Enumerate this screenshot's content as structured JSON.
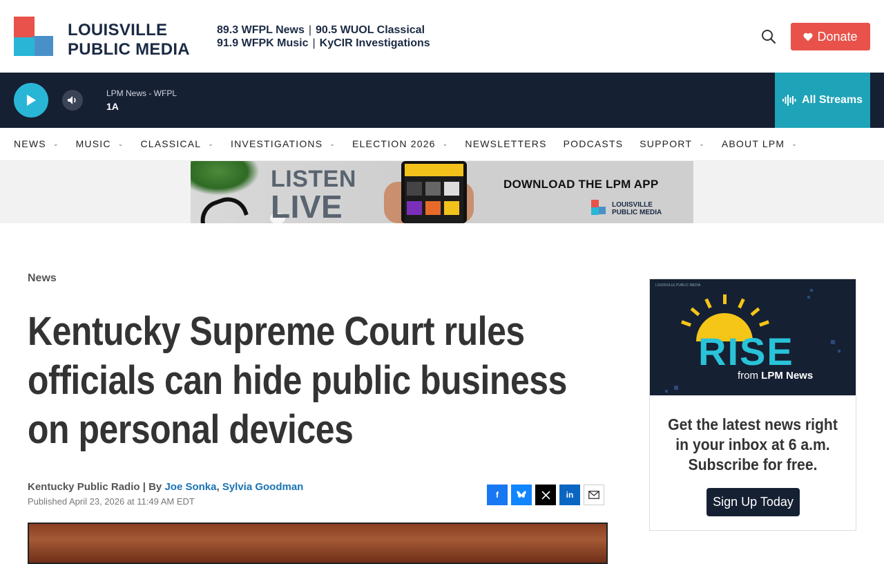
{
  "header": {
    "logo_line1": "LOUISVILLE",
    "logo_line2": "PUBLIC MEDIA",
    "stations": {
      "row1_a": "89.3 WFPL News",
      "row1_b": "90.5 WUOL Classical",
      "row2_a": "91.9 WFPK Music",
      "row2_b": "KyCIR Investigations",
      "separator": "|"
    },
    "search_icon": "search-icon",
    "donate_label": "Donate",
    "donate_icon": "heart-icon",
    "donate_color": "#e8524a"
  },
  "player": {
    "station": "LPM News - WFPL",
    "show": "1A",
    "all_streams_label": "All Streams",
    "accent": "#29b6d6",
    "bar_color": "#162033"
  },
  "nav": {
    "items": [
      {
        "label": "NEWS",
        "dropdown": true
      },
      {
        "label": "MUSIC",
        "dropdown": true
      },
      {
        "label": "CLASSICAL",
        "dropdown": true
      },
      {
        "label": "INVESTIGATIONS",
        "dropdown": true
      },
      {
        "label": "ELECTION 2026",
        "dropdown": true
      },
      {
        "label": "NEWSLETTERS",
        "dropdown": false
      },
      {
        "label": "PODCASTS",
        "dropdown": false
      },
      {
        "label": "SUPPORT",
        "dropdown": true
      },
      {
        "label": "ABOUT LPM",
        "dropdown": true
      }
    ]
  },
  "banner": {
    "listen": "LISTEN",
    "live": "LIVE",
    "cta": "DOWNLOAD THE LPM APP",
    "logo_line1": "LOUISVILLE",
    "logo_line2": "PUBLIC MEDIA"
  },
  "article": {
    "kicker": "News",
    "headline": "Kentucky Supreme Court rules officials can hide public business on personal devices",
    "source": "Kentucky Public Radio",
    "by": "| By",
    "author1": "Joe Sonka",
    "author2": "Sylvia Goodman",
    "published": "Published April 23, 2026 at 11:49 AM EDT"
  },
  "share": {
    "facebook": "f",
    "bluesky": "bluesky-icon",
    "x": "x-icon",
    "linkedin": "in",
    "email": "email-icon"
  },
  "promo": {
    "brand_small": "LOUISVILLE PUBLIC MEDIA",
    "rise": "RISE",
    "from": "from",
    "from_brand": "LPM News",
    "copy": "Get the latest news right in your inbox at 6 a.m. Subscribe for free.",
    "signup_label": "Sign Up Today"
  }
}
